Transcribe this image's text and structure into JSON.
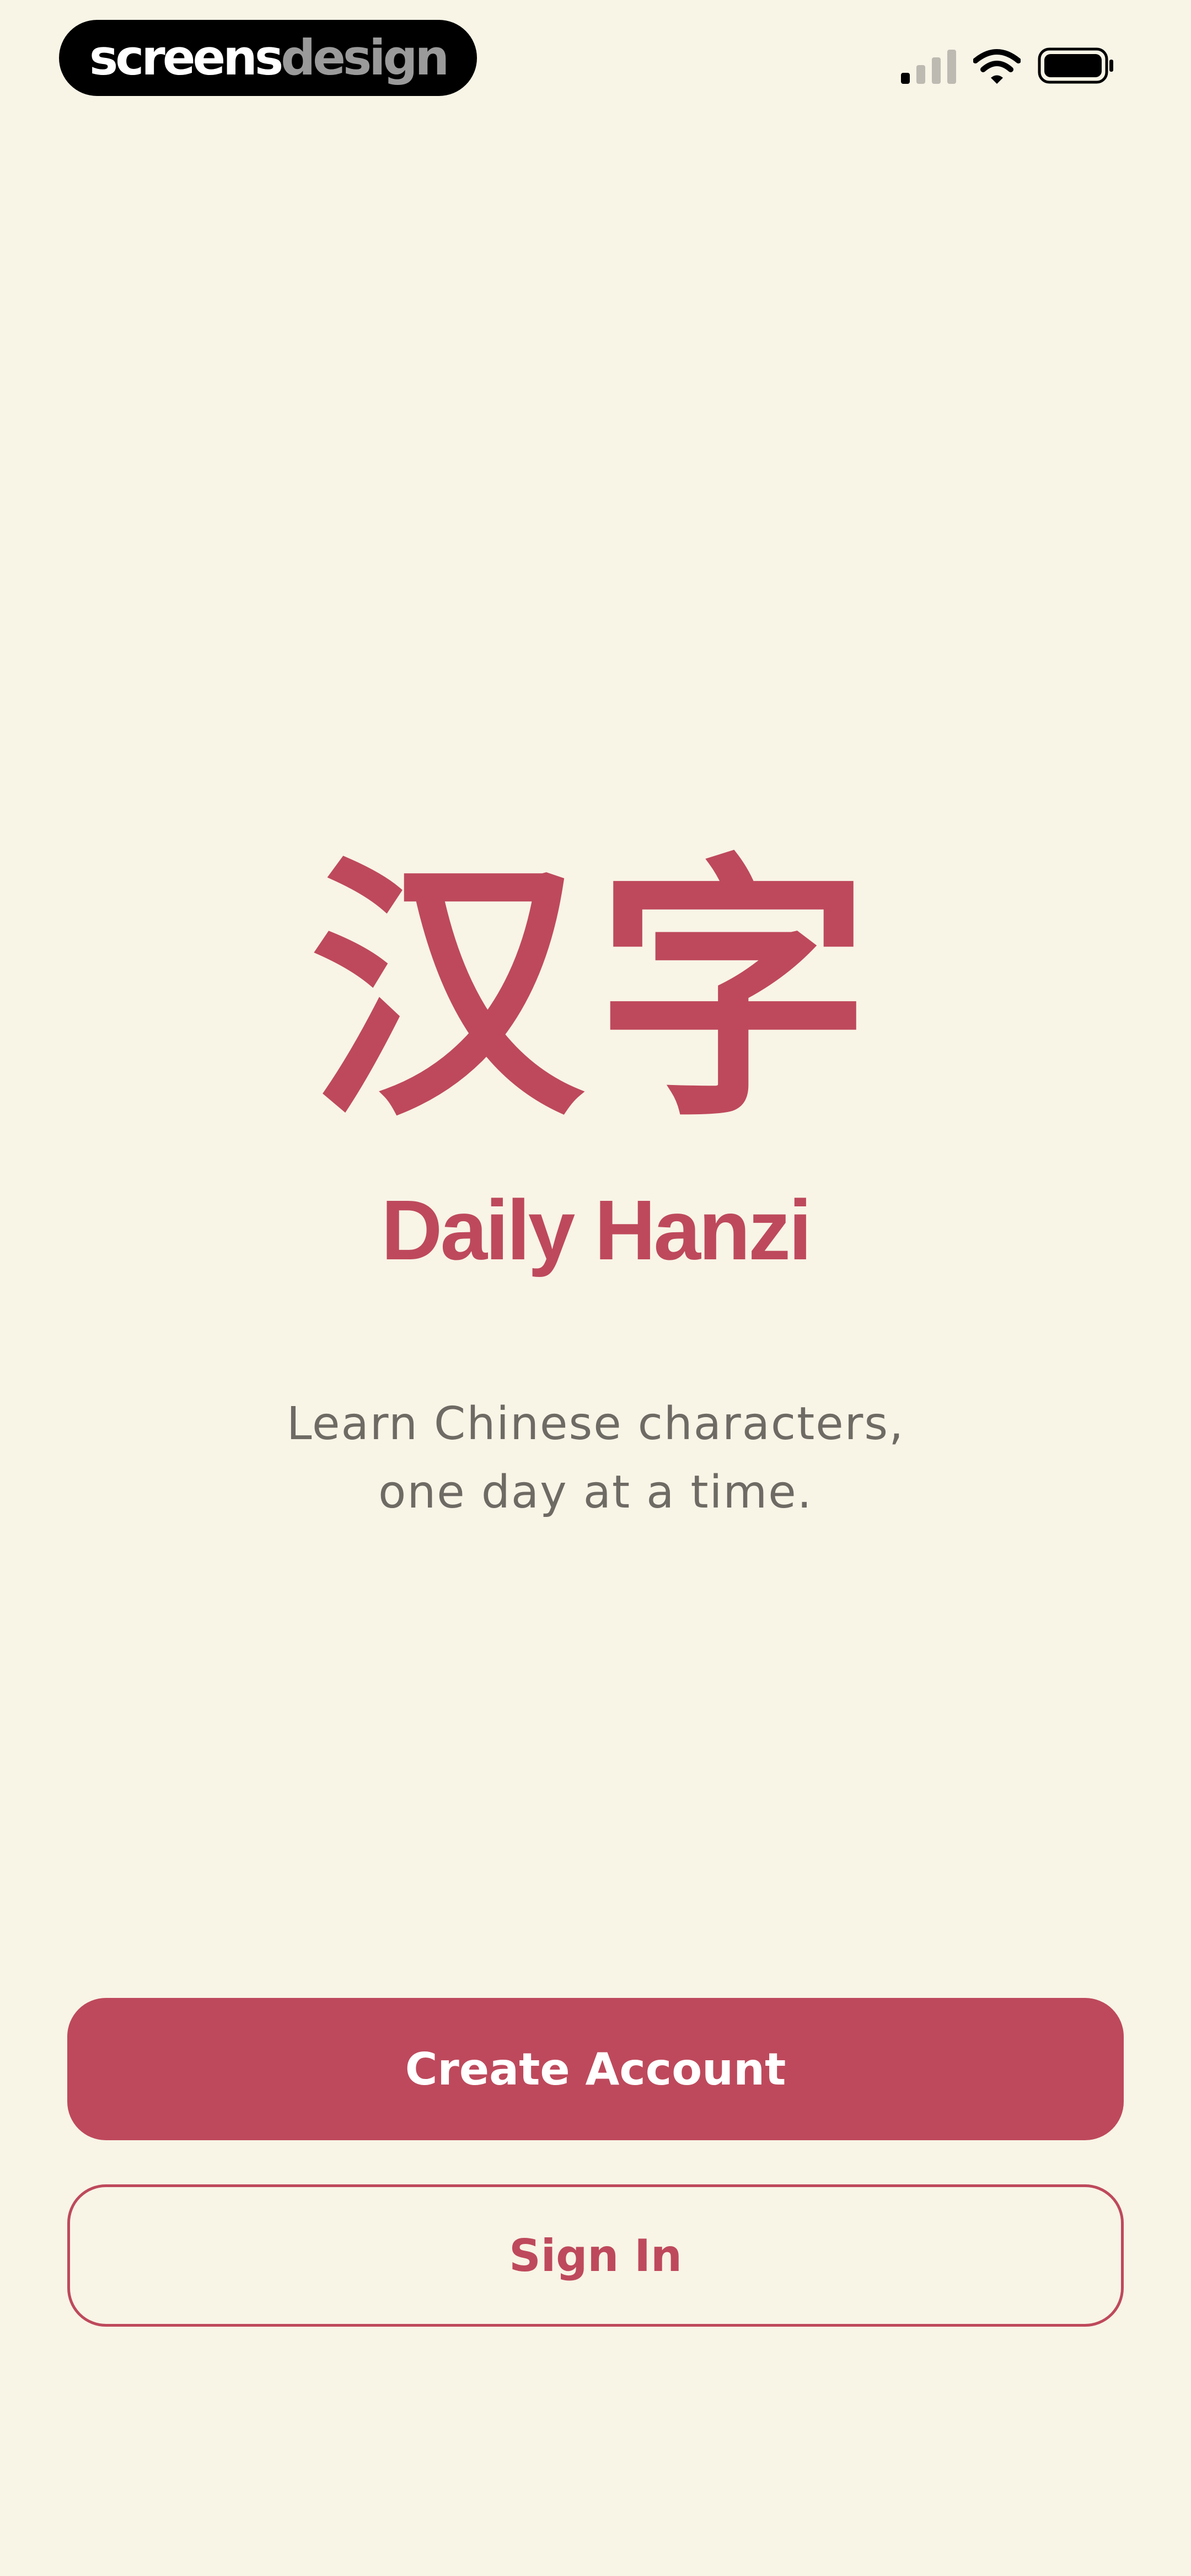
{
  "status_bar": {
    "brand_part_a": "screens",
    "brand_part_b": "design",
    "icons": [
      "cellular-signal-icon",
      "wifi-icon",
      "battery-icon"
    ]
  },
  "hero": {
    "logo_characters": "汉字",
    "app_title": "Daily Hanzi",
    "tagline_line1": "Learn Chinese characters,",
    "tagline_line2": "one day at a time."
  },
  "actions": {
    "create_account_label": "Create Account",
    "sign_in_label": "Sign In"
  },
  "colors": {
    "background": "#F8F4E6",
    "accent": "#BE495C",
    "tagline_text": "#6E6A64",
    "badge_background": "#000000"
  }
}
